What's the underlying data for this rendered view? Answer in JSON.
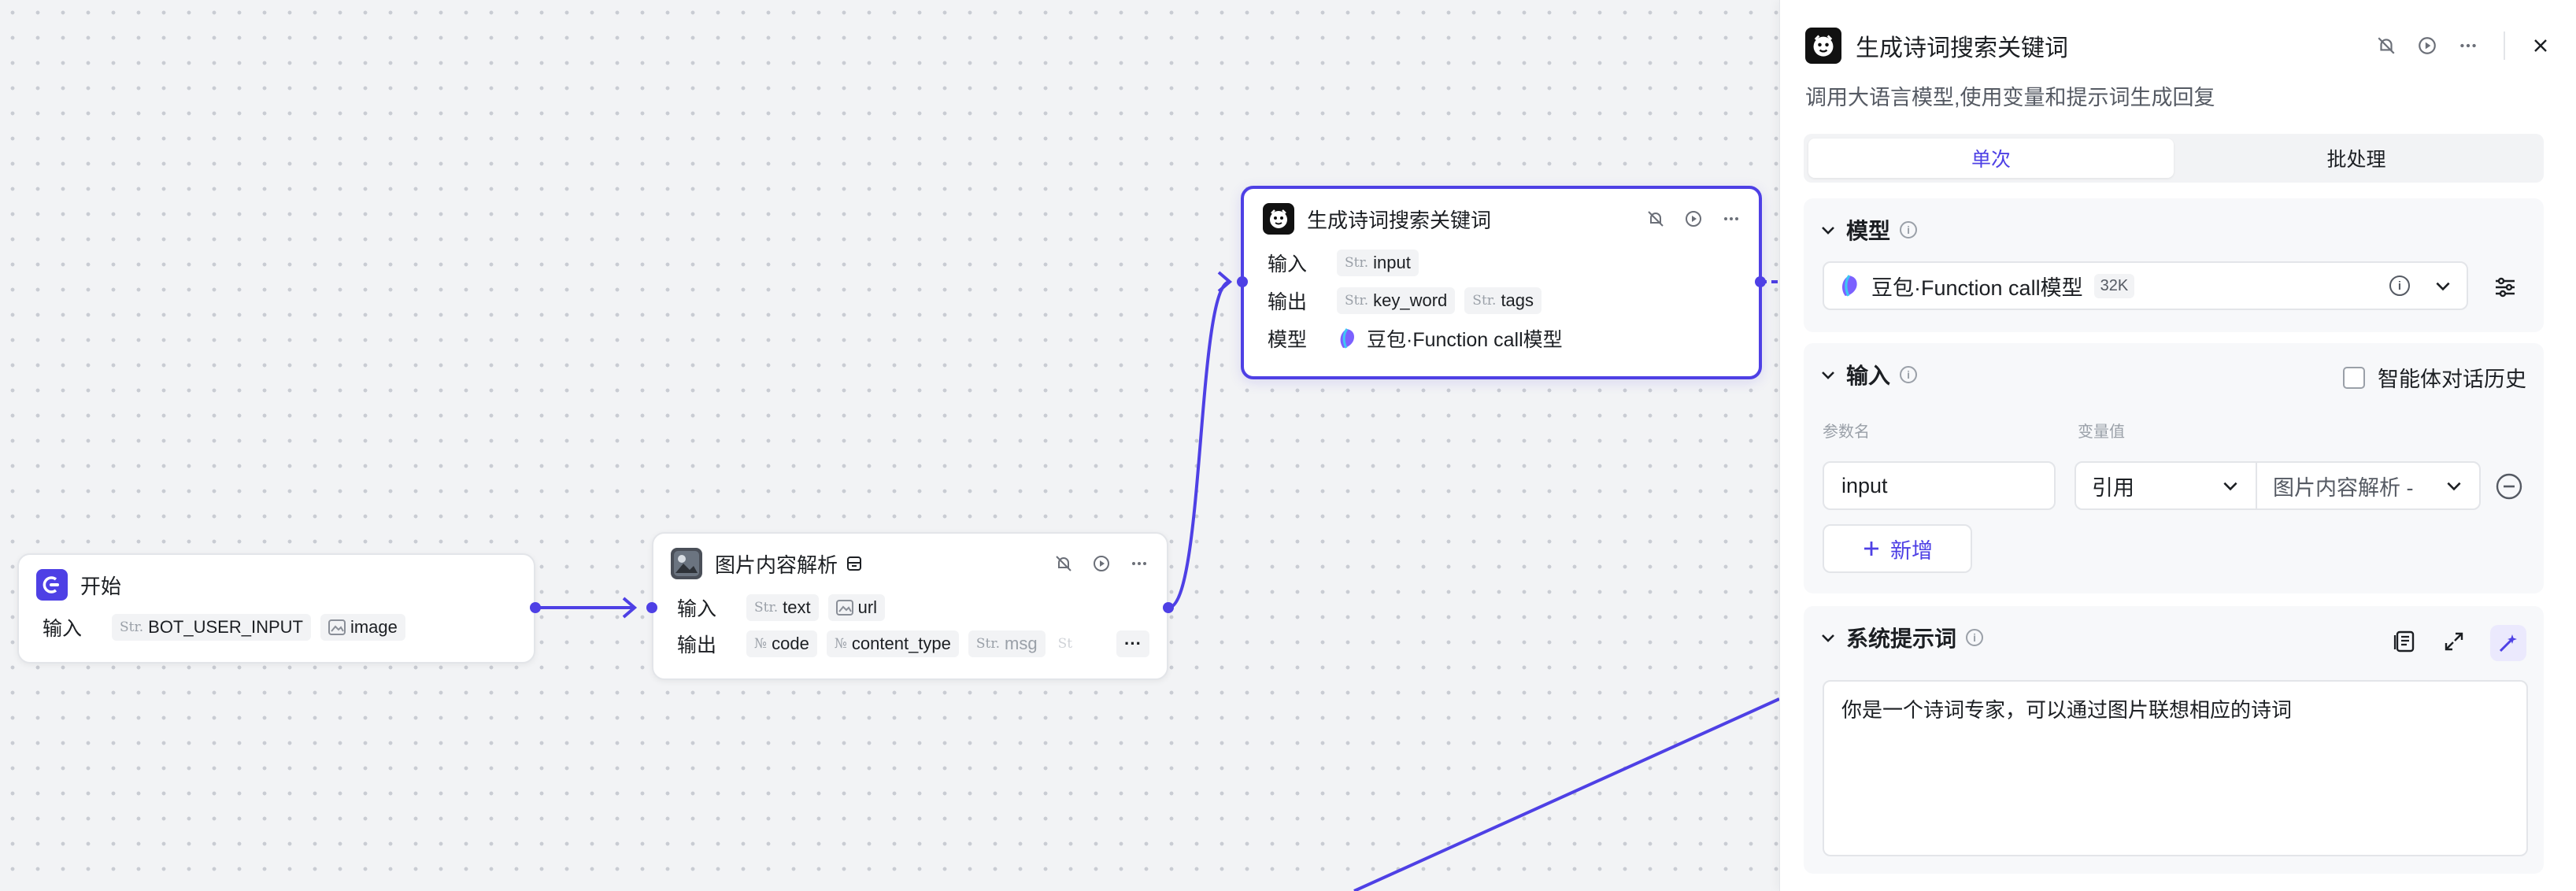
{
  "colors": {
    "accent": "#4e40e5",
    "canvas": "#f2f3f5",
    "panel": "#ffffff",
    "muted": "#9aa0a8"
  },
  "type_prefix": {
    "string": "Str.",
    "number": "№"
  },
  "nodes": {
    "start": {
      "title": "开始",
      "input_label": "输入",
      "inputs": [
        {
          "type": "Str.",
          "name": "BOT_USER_INPUT"
        },
        {
          "type": "image-icon",
          "name": "image"
        }
      ]
    },
    "image_parse": {
      "title": "图片内容解析",
      "input_label": "输入",
      "output_label": "输出",
      "inputs": [
        {
          "type": "Str.",
          "name": "text"
        },
        {
          "type": "image-icon",
          "name": "url"
        }
      ],
      "outputs": [
        {
          "type": "№",
          "name": "code"
        },
        {
          "type": "№",
          "name": "content_type"
        },
        {
          "type": "Str.",
          "name": "msg"
        },
        {
          "type": "St",
          "name": ""
        }
      ],
      "more": "···"
    },
    "llm": {
      "title": "生成诗词搜索关键词",
      "input_label": "输入",
      "output_label": "输出",
      "model_label": "模型",
      "inputs": [
        {
          "type": "Str.",
          "name": "input"
        }
      ],
      "outputs": [
        {
          "type": "Str.",
          "name": "key_word"
        },
        {
          "type": "Str.",
          "name": "tags"
        }
      ],
      "model": "豆包·Function call模型"
    }
  },
  "panel": {
    "title": "生成诗词搜索关键词",
    "description": "调用大语言模型,使用变量和提示词生成回复",
    "tabs": [
      {
        "label": "单次",
        "active": true
      },
      {
        "label": "批处理",
        "active": false
      }
    ],
    "model_section": {
      "title": "模型",
      "model_name": "豆包·Function call模型",
      "context_badge": "32K"
    },
    "input_section": {
      "title": "输入",
      "chat_history_label": "智能体对话历史",
      "chat_history_checked": false,
      "col_param": "参数名",
      "col_value": "变量值",
      "param_name": "input",
      "value_mode": "引用",
      "value_ref": "图片内容解析 -",
      "add_label": "新增"
    },
    "prompt_section": {
      "title": "系统提示词",
      "prompt": "你是一个诗词专家，可以通过图片联想相应的诗词"
    }
  }
}
